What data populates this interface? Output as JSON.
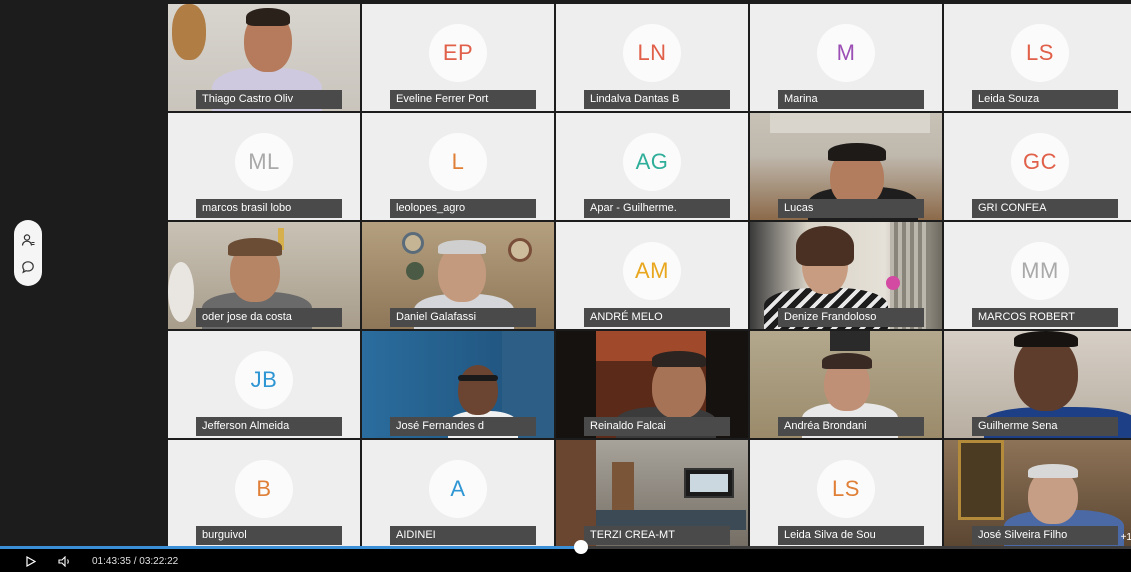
{
  "participants": [
    {
      "name": "Thiago Castro Oliv",
      "type": "video",
      "scene": "wall-guitar"
    },
    {
      "name": "Eveline Ferrer Port",
      "type": "avatar",
      "initials": "EP",
      "color": "#e0604a"
    },
    {
      "name": "Lindalva Dantas B",
      "type": "avatar",
      "initials": "LN",
      "color": "#e0604a"
    },
    {
      "name": "Marina",
      "type": "avatar",
      "initials": "M",
      "color": "#9b4fb5"
    },
    {
      "name": "Leida Souza",
      "type": "avatar",
      "initials": "LS",
      "color": "#e0604a"
    },
    {
      "name": "marcos brasil lobo",
      "type": "avatar",
      "initials": "ML",
      "color": "#a9a9a9"
    },
    {
      "name": "leolopes_agro",
      "type": "avatar",
      "initials": "L",
      "color": "#e08038"
    },
    {
      "name": "Apar - Guilherme.",
      "type": "avatar",
      "initials": "AG",
      "color": "#2fae9a"
    },
    {
      "name": "Lucas",
      "type": "video",
      "scene": "ceiling-man"
    },
    {
      "name": "GRI CONFEA",
      "type": "avatar",
      "initials": "GC",
      "color": "#e0604a"
    },
    {
      "name": "oder jose da costa",
      "type": "video",
      "scene": "room-man"
    },
    {
      "name": "Daniel Galafassi",
      "type": "video",
      "scene": "plates-man"
    },
    {
      "name": "ANDRÉ MELO",
      "type": "avatar",
      "initials": "AM",
      "color": "#e8a71e"
    },
    {
      "name": "Denize Frandoloso",
      "type": "video",
      "scene": "woman-window"
    },
    {
      "name": "MARCOS ROBERT",
      "type": "avatar",
      "initials": "MM",
      "color": "#a9a9a9"
    },
    {
      "name": "Jefferson Almeida",
      "type": "avatar",
      "initials": "JB",
      "color": "#2f96d4"
    },
    {
      "name": "José Fernandes d",
      "type": "video",
      "scene": "blue-wall"
    },
    {
      "name": "Reinaldo Falcai",
      "type": "video",
      "scene": "dark-man"
    },
    {
      "name": "Andréa Brondani",
      "type": "video",
      "scene": "office-woman"
    },
    {
      "name": "Guilherme Sena",
      "type": "video",
      "scene": "closeup-man"
    },
    {
      "name": "burguivol",
      "type": "avatar",
      "initials": "B",
      "color": "#e08038"
    },
    {
      "name": "AIDINEI",
      "type": "avatar",
      "initials": "A",
      "color": "#2f96d4"
    },
    {
      "name": "TERZI CREA-MT",
      "type": "video",
      "scene": "office-tv"
    },
    {
      "name": "Leida Silva de Sou",
      "type": "avatar",
      "initials": "LS",
      "color": "#e08038"
    },
    {
      "name": "José Silveira Filho",
      "type": "video",
      "scene": "painting-man"
    }
  ],
  "more_count": "+1",
  "player": {
    "time_display": "01:43:35 / 03:22:22",
    "progress": 0.5139,
    "accent": "#3a8fd6"
  },
  "side_panel_icons": [
    "participants-icon",
    "chat-icon"
  ]
}
